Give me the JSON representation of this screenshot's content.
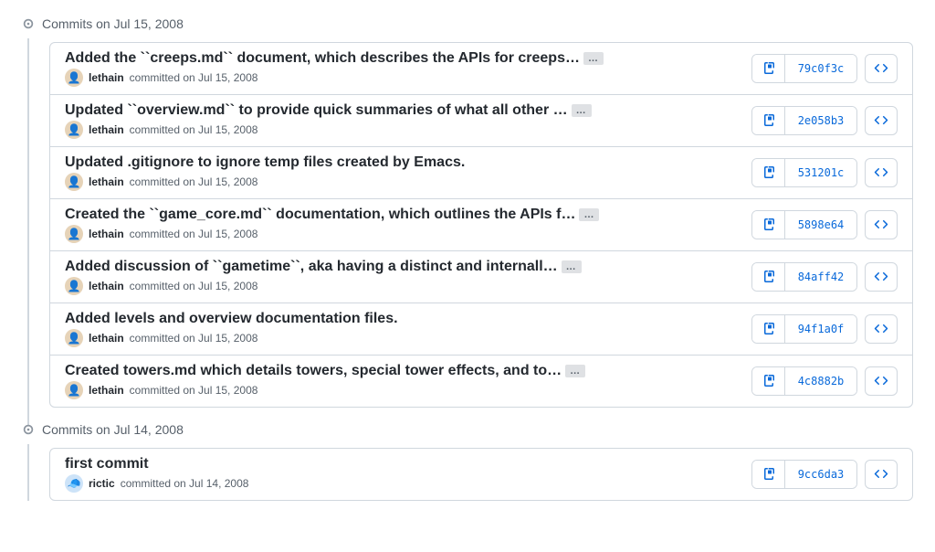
{
  "groups": [
    {
      "title": "Commits on Jul 15, 2008",
      "commits": [
        {
          "title": "Added the ``creeps.md`` document, which describes the APIs for creeps…",
          "has_expand": true,
          "author": "lethain",
          "avatar_kind": "lethain",
          "meta": "committed on Jul 15, 2008",
          "sha": "79c0f3c"
        },
        {
          "title": "Updated ``overview.md`` to provide quick summaries of what all other …",
          "has_expand": true,
          "author": "lethain",
          "avatar_kind": "lethain",
          "meta": "committed on Jul 15, 2008",
          "sha": "2e058b3"
        },
        {
          "title": "Updated .gitignore to ignore temp files created by Emacs.",
          "has_expand": false,
          "author": "lethain",
          "avatar_kind": "lethain",
          "meta": "committed on Jul 15, 2008",
          "sha": "531201c"
        },
        {
          "title": "Created the ``game_core.md`` documentation, which outlines the APIs f…",
          "has_expand": true,
          "author": "lethain",
          "avatar_kind": "lethain",
          "meta": "committed on Jul 15, 2008",
          "sha": "5898e64"
        },
        {
          "title": "Added discussion of ``gametime``, aka having a distinct and internall…",
          "has_expand": true,
          "author": "lethain",
          "avatar_kind": "lethain",
          "meta": "committed on Jul 15, 2008",
          "sha": "84aff42"
        },
        {
          "title": "Added levels and overview documentation files.",
          "has_expand": false,
          "author": "lethain",
          "avatar_kind": "lethain",
          "meta": "committed on Jul 15, 2008",
          "sha": "94f1a0f"
        },
        {
          "title": "Created towers.md which details towers, special tower effects, and to…",
          "has_expand": true,
          "author": "lethain",
          "avatar_kind": "lethain",
          "meta": "committed on Jul 15, 2008",
          "sha": "4c8882b"
        }
      ]
    },
    {
      "title": "Commits on Jul 14, 2008",
      "commits": [
        {
          "title": "first commit",
          "has_expand": false,
          "author": "rictic",
          "avatar_kind": "rictic",
          "meta": "committed on Jul 14, 2008",
          "sha": "9cc6da3"
        }
      ]
    }
  ]
}
